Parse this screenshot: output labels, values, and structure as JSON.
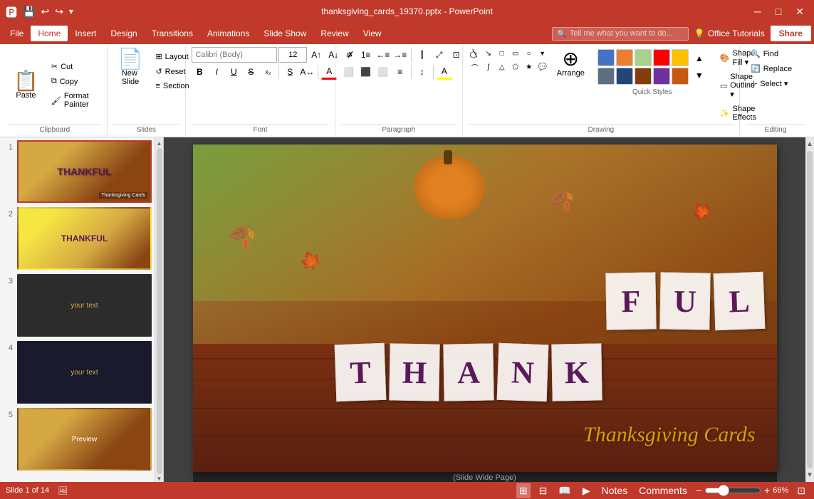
{
  "titleBar": {
    "title": "thanksgiving_cards_19370.pptx - PowerPoint",
    "windowControls": {
      "minimize": "─",
      "maximize": "□",
      "close": "✕"
    }
  },
  "menuBar": {
    "items": [
      "File",
      "Home",
      "Insert",
      "Design",
      "Transitions",
      "Animations",
      "Slide Show",
      "Review",
      "View"
    ],
    "activeItem": "Home",
    "searchPlaceholder": "Tell me what you want to do...",
    "officeTutorials": "Office Tutorials",
    "share": "Share"
  },
  "ribbon": {
    "clipboard": {
      "label": "Clipboard",
      "paste": "Paste",
      "cut": "Cut",
      "copy": "Copy",
      "formatPainter": "Format Painter"
    },
    "slides": {
      "label": "Slides",
      "newSlide": "New\nSlide",
      "layout": "Layout",
      "reset": "Reset",
      "section": "Section"
    },
    "font": {
      "label": "Font",
      "fontName": "",
      "fontSize": "12",
      "bold": "B",
      "italic": "I",
      "underline": "U",
      "strikethrough": "S",
      "fontColor": "A",
      "clearFormatting": "✗"
    },
    "paragraph": {
      "label": "Paragraph"
    },
    "drawing": {
      "label": "Drawing",
      "arrange": "Arrange",
      "quickStyles": "Quick Styles",
      "shapeFill": "Shape Fill ▾",
      "shapeOutline": "Shape Outline ▾",
      "shapeEffects": "Shape Effects"
    },
    "editing": {
      "label": "Editing",
      "find": "Find",
      "replace": "Replace",
      "select": "Select ▾"
    }
  },
  "slides": [
    {
      "num": 1,
      "starred": false,
      "selected": true
    },
    {
      "num": 2,
      "starred": true,
      "selected": false
    },
    {
      "num": 3,
      "starred": true,
      "selected": false
    },
    {
      "num": 4,
      "starred": false,
      "selected": false
    },
    {
      "num": 5,
      "starred": false,
      "selected": false
    }
  ],
  "slideCanvas": {
    "letters_row1": [
      "T",
      "H",
      "A",
      "N",
      "K"
    ],
    "letters_row2": [
      "F",
      "U",
      "L"
    ],
    "tcText": "Thanksgiving Cards",
    "captionText": "(Slide Wide Page)"
  },
  "statusBar": {
    "slideInfo": "Slide 1 of 14",
    "notes": "Notes",
    "comments": "Comments",
    "zoom": "66%",
    "zoomValue": 66
  }
}
